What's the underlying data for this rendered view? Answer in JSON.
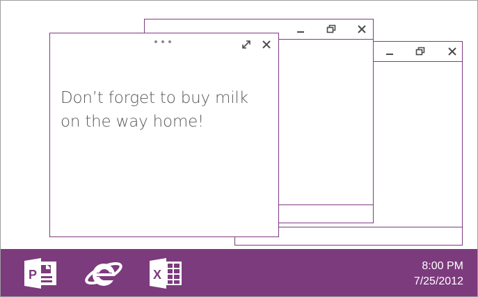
{
  "note": {
    "text": "Don’t forget to buy milk on the way home!"
  },
  "taskbar": {
    "apps": [
      {
        "name": "PowerPoint",
        "icon": "powerpoint-icon"
      },
      {
        "name": "Internet Explorer",
        "icon": "internet-explorer-icon"
      },
      {
        "name": "Excel",
        "icon": "excel-icon"
      }
    ],
    "clock": {
      "time": "8:00 PM",
      "date": "7/25/2012"
    },
    "color": "#7c3b7d"
  },
  "colors": {
    "window_border": "#7e3a80",
    "text": "#595959"
  }
}
